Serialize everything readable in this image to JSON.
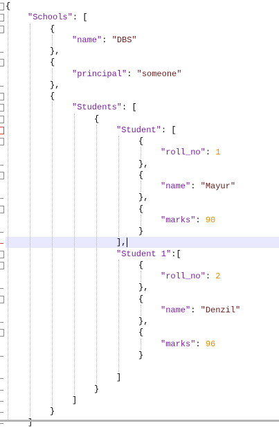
{
  "editor": {
    "lines": [
      {
        "indent": 0,
        "tokens": [
          {
            "t": "punc",
            "v": "{"
          }
        ]
      },
      {
        "indent": 1,
        "tokens": [
          {
            "t": "key",
            "v": "\"Schools\""
          },
          {
            "t": "punc",
            "v": ": ["
          }
        ]
      },
      {
        "indent": 2,
        "tokens": [
          {
            "t": "punc",
            "v": "{"
          }
        ]
      },
      {
        "indent": 3,
        "tokens": [
          {
            "t": "key",
            "v": "\"name\""
          },
          {
            "t": "punc",
            "v": ": "
          },
          {
            "t": "str",
            "v": "\"DBS\""
          }
        ]
      },
      {
        "indent": 2,
        "tokens": [
          {
            "t": "punc",
            "v": "},"
          }
        ]
      },
      {
        "indent": 2,
        "tokens": [
          {
            "t": "punc",
            "v": "{"
          }
        ]
      },
      {
        "indent": 3,
        "tokens": [
          {
            "t": "key",
            "v": "\"principal\""
          },
          {
            "t": "punc",
            "v": ": "
          },
          {
            "t": "str",
            "v": "\"someone\""
          }
        ]
      },
      {
        "indent": 2,
        "tokens": [
          {
            "t": "punc",
            "v": "},"
          }
        ]
      },
      {
        "indent": 2,
        "tokens": [
          {
            "t": "punc",
            "v": "{"
          }
        ]
      },
      {
        "indent": 3,
        "tokens": [
          {
            "t": "key",
            "v": "\"Students\""
          },
          {
            "t": "punc",
            "v": ": ["
          }
        ]
      },
      {
        "indent": 4,
        "tokens": [
          {
            "t": "punc",
            "v": "{"
          }
        ]
      },
      {
        "indent": 5,
        "tokens": [
          {
            "t": "key",
            "v": "\"Student\""
          },
          {
            "t": "punc",
            "v": ": ["
          }
        ]
      },
      {
        "indent": 6,
        "tokens": [
          {
            "t": "punc",
            "v": "{"
          }
        ]
      },
      {
        "indent": 7,
        "tokens": [
          {
            "t": "key",
            "v": "\"roll_no\""
          },
          {
            "t": "punc",
            "v": ": "
          },
          {
            "t": "num",
            "v": "1"
          }
        ]
      },
      {
        "indent": 6,
        "tokens": [
          {
            "t": "punc",
            "v": "},"
          }
        ]
      },
      {
        "indent": 6,
        "tokens": [
          {
            "t": "punc",
            "v": "{"
          }
        ]
      },
      {
        "indent": 7,
        "tokens": [
          {
            "t": "key",
            "v": "\"name\""
          },
          {
            "t": "punc",
            "v": ": "
          },
          {
            "t": "str",
            "v": "\"Mayur\""
          }
        ]
      },
      {
        "indent": 6,
        "tokens": [
          {
            "t": "punc",
            "v": "},"
          }
        ]
      },
      {
        "indent": 6,
        "tokens": [
          {
            "t": "punc",
            "v": "{"
          }
        ]
      },
      {
        "indent": 7,
        "tokens": [
          {
            "t": "key",
            "v": "\"marks\""
          },
          {
            "t": "punc",
            "v": ": "
          },
          {
            "t": "num",
            "v": "90"
          }
        ]
      },
      {
        "indent": 6,
        "tokens": [
          {
            "t": "punc",
            "v": "}"
          }
        ]
      },
      {
        "indent": 5,
        "tokens": [
          {
            "t": "punc",
            "v": "],"
          }
        ],
        "current": true
      },
      {
        "indent": 5,
        "tokens": [
          {
            "t": "key",
            "v": "\"Student 1\""
          },
          {
            "t": "punc",
            "v": ":["
          }
        ]
      },
      {
        "indent": 6,
        "tokens": [
          {
            "t": "punc",
            "v": "{"
          }
        ]
      },
      {
        "indent": 7,
        "tokens": [
          {
            "t": "key",
            "v": "\"roll_no\""
          },
          {
            "t": "punc",
            "v": ": "
          },
          {
            "t": "num",
            "v": "2"
          }
        ]
      },
      {
        "indent": 6,
        "tokens": [
          {
            "t": "punc",
            "v": "},"
          }
        ]
      },
      {
        "indent": 6,
        "tokens": [
          {
            "t": "punc",
            "v": "{"
          }
        ]
      },
      {
        "indent": 7,
        "tokens": [
          {
            "t": "key",
            "v": "\"name\""
          },
          {
            "t": "punc",
            "v": ": "
          },
          {
            "t": "str",
            "v": "\"Denzil\""
          }
        ]
      },
      {
        "indent": 6,
        "tokens": [
          {
            "t": "punc",
            "v": "},"
          }
        ]
      },
      {
        "indent": 6,
        "tokens": [
          {
            "t": "punc",
            "v": "{"
          }
        ]
      },
      {
        "indent": 7,
        "tokens": [
          {
            "t": "key",
            "v": "\"marks\""
          },
          {
            "t": "punc",
            "v": ": "
          },
          {
            "t": "num",
            "v": "96"
          }
        ]
      },
      {
        "indent": 6,
        "tokens": [
          {
            "t": "punc",
            "v": "}"
          }
        ]
      },
      {
        "indent": 0,
        "tokens": []
      },
      {
        "indent": 5,
        "tokens": [
          {
            "t": "punc",
            "v": "]"
          }
        ]
      },
      {
        "indent": 4,
        "tokens": [
          {
            "t": "punc",
            "v": "}"
          }
        ]
      },
      {
        "indent": 3,
        "tokens": [
          {
            "t": "punc",
            "v": "]"
          }
        ]
      },
      {
        "indent": 2,
        "tokens": [
          {
            "t": "punc",
            "v": "}"
          }
        ]
      },
      {
        "indent": 1,
        "tokens": [
          {
            "t": "punc",
            "v": "]"
          }
        ]
      }
    ],
    "colors": {
      "key": "#7a1fa2",
      "string": "#6b1a1a",
      "number": "#f08c00",
      "current_line": "#e8e8ff"
    }
  }
}
